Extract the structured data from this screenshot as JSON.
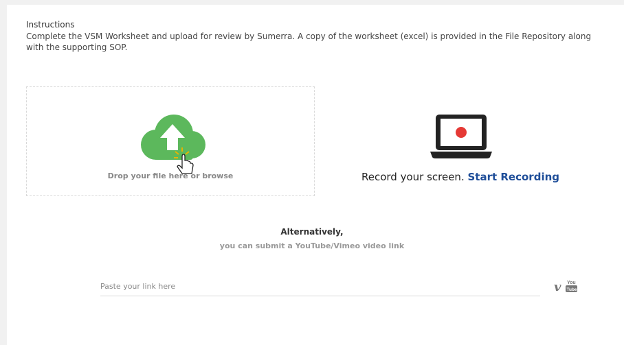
{
  "instructions": {
    "title": "Instructions",
    "text": "Complete the VSM Worksheet and upload for review by Sumerra.  A copy of the worksheet (excel) is provided in the File Repository along with the supporting SOP."
  },
  "upload": {
    "drop_text": "Drop your file here or browse",
    "icon": "cloud-upload-icon",
    "cloud_color": "#5cb85c"
  },
  "record": {
    "text": "Record your screen.",
    "link": "Start Recording",
    "icon": "laptop-record-icon",
    "record_dot_color": "#e53935"
  },
  "alternative": {
    "title": "Alternatively,",
    "subtitle": "you can submit a YouTube/Vimeo video link"
  },
  "video_link": {
    "placeholder": "Paste your link here",
    "value": ""
  },
  "video_icons": {
    "vimeo_label": "v",
    "youtube_top": "You",
    "youtube_bottom": "Tube"
  }
}
